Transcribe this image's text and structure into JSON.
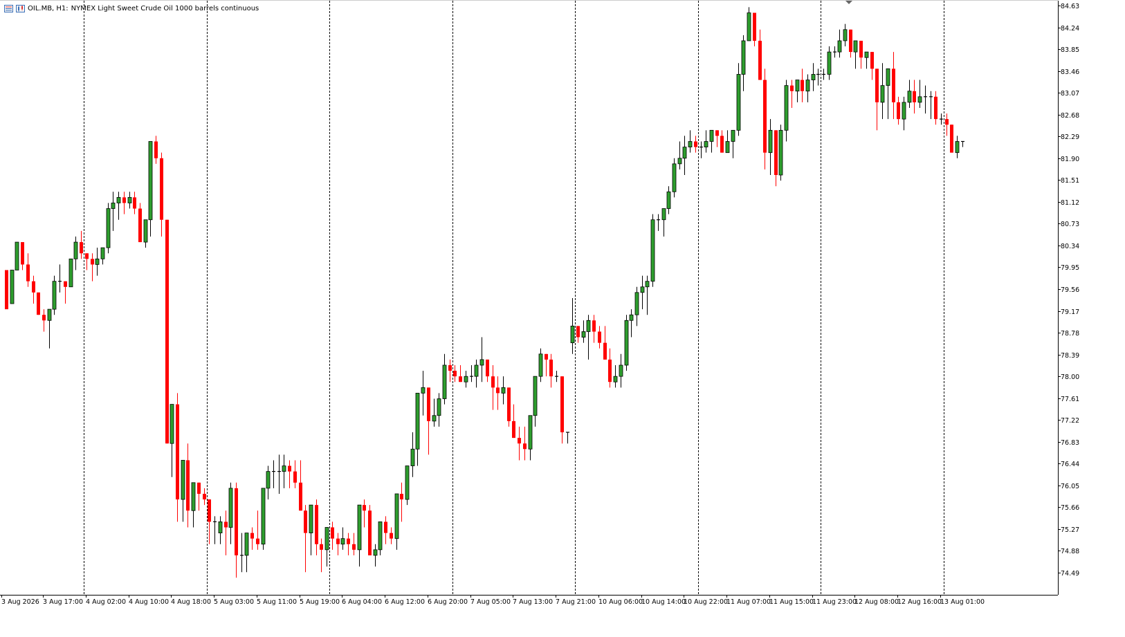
{
  "header": {
    "symbol": "OIL.MB, H1:",
    "description": "NYMEX Light Sweet Crude Oil 1000 barrels continuous",
    "icons": [
      "menu-icon",
      "chart-type-icon"
    ]
  },
  "colors": {
    "up": "#008000",
    "up_fill": "#2e9e2e",
    "down": "#ff0000",
    "grid_separator": "#000000",
    "axis": "#000000",
    "background": "#ffffff"
  },
  "chart_data": {
    "type": "candlestick",
    "timeframe": "H1",
    "ylim": [
      74.3,
      84.8
    ],
    "y_ticks": [
      "84.63",
      "84.24",
      "83.85",
      "83.46",
      "83.07",
      "82.68",
      "82.29",
      "81.90",
      "81.51",
      "81.12",
      "80.73",
      "80.34",
      "79.95",
      "79.56",
      "79.17",
      "78.78",
      "78.39",
      "78.00",
      "77.61",
      "77.22",
      "76.83",
      "76.44",
      "76.05",
      "75.66",
      "75.27",
      "74.88",
      "74.49"
    ],
    "x_labels": [
      "3 Aug 2026",
      "3 Aug 17:00",
      "4 Aug 02:00",
      "4 Aug 10:00",
      "4 Aug 18:00",
      "5 Aug 03:00",
      "5 Aug 11:00",
      "5 Aug 19:00",
      "6 Aug 04:00",
      "6 Aug 12:00",
      "6 Aug 20:00",
      "7 Aug 05:00",
      "7 Aug 13:00",
      "7 Aug 21:00",
      "10 Aug 06:00",
      "10 Aug 14:00",
      "10 Aug 22:00",
      "11 Aug 07:00",
      "11 Aug 15:00",
      "11 Aug 23:00",
      "12 Aug 08:00",
      "12 Aug 16:00",
      "13 Aug 01:00"
    ],
    "day_separators_after_candle": [
      14,
      37,
      60,
      83,
      106,
      129,
      152,
      175
    ],
    "candles": [
      [
        79.9,
        79.9,
        79.5,
        79.2
      ],
      [
        79.3,
        79.9,
        79.5,
        79.9
      ],
      [
        79.9,
        80.4,
        80.2,
        80.4
      ],
      [
        80.4,
        80.4,
        79.9,
        80.0
      ],
      [
        80.0,
        80.2,
        79.6,
        79.7
      ],
      [
        79.7,
        79.8,
        79.3,
        79.5
      ],
      [
        79.5,
        79.5,
        79.1,
        79.1
      ],
      [
        79.1,
        79.2,
        78.8,
        79.0
      ],
      [
        79.0,
        79.2,
        78.5,
        79.2
      ],
      [
        79.2,
        79.8,
        79.1,
        79.7
      ],
      [
        79.7,
        80.0,
        79.5,
        79.7
      ],
      [
        79.7,
        79.7,
        79.3,
        79.6
      ],
      [
        79.6,
        80.1,
        79.6,
        80.1
      ],
      [
        80.1,
        80.5,
        79.9,
        80.4
      ],
      [
        80.4,
        80.6,
        80.1,
        80.2
      ],
      [
        80.2,
        80.2,
        79.9,
        80.1
      ],
      [
        80.1,
        80.2,
        79.7,
        80.0
      ],
      [
        80.0,
        80.3,
        79.8,
        80.1
      ],
      [
        80.1,
        80.3,
        80.0,
        80.3
      ],
      [
        80.3,
        81.1,
        80.2,
        81.0
      ],
      [
        81.0,
        81.3,
        80.6,
        81.1
      ],
      [
        81.1,
        81.3,
        80.8,
        81.2
      ],
      [
        81.2,
        81.3,
        80.9,
        81.1
      ],
      [
        81.1,
        81.3,
        81.0,
        81.2
      ],
      [
        81.2,
        81.3,
        80.9,
        81.0
      ],
      [
        81.0,
        81.1,
        80.4,
        80.4
      ],
      [
        80.4,
        80.7,
        80.3,
        80.8
      ],
      [
        80.8,
        82.2,
        80.5,
        82.2
      ],
      [
        82.2,
        82.3,
        81.8,
        81.9
      ],
      [
        81.9,
        82.0,
        80.5,
        80.8
      ],
      [
        80.8,
        80.8,
        76.8,
        76.8
      ],
      [
        76.8,
        77.5,
        76.2,
        77.5
      ],
      [
        77.5,
        77.7,
        75.4,
        75.8
      ],
      [
        75.8,
        76.3,
        75.4,
        76.5
      ],
      [
        76.5,
        76.8,
        75.3,
        75.6
      ],
      [
        75.6,
        76.1,
        75.3,
        76.1
      ],
      [
        76.1,
        76.1,
        75.6,
        75.9
      ],
      [
        75.9,
        76.0,
        75.7,
        75.8
      ],
      [
        75.8,
        75.8,
        75.0,
        75.4
      ],
      [
        75.4,
        75.5,
        75.0,
        75.4
      ],
      [
        75.2,
        75.5,
        75.0,
        75.4
      ],
      [
        75.4,
        75.6,
        74.8,
        75.3
      ],
      [
        75.3,
        76.1,
        75.0,
        76.0
      ],
      [
        76.0,
        76.1,
        74.4,
        74.8
      ],
      [
        74.8,
        75.2,
        74.5,
        74.8
      ],
      [
        74.8,
        75.2,
        74.5,
        75.2
      ],
      [
        75.2,
        75.3,
        74.9,
        75.1
      ],
      [
        75.1,
        75.6,
        74.9,
        75.0
      ],
      [
        75.0,
        76.0,
        74.9,
        76.0
      ],
      [
        76.0,
        76.4,
        75.8,
        76.3
      ],
      [
        76.3,
        76.5,
        76.0,
        76.3
      ],
      [
        76.3,
        76.6,
        75.9,
        76.3
      ],
      [
        76.3,
        76.6,
        76.0,
        76.4
      ],
      [
        76.4,
        76.5,
        76.0,
        76.3
      ],
      [
        76.3,
        76.5,
        76.0,
        76.1
      ],
      [
        76.1,
        76.5,
        75.6,
        75.6
      ],
      [
        75.6,
        75.7,
        74.5,
        75.2
      ],
      [
        75.2,
        75.7,
        74.8,
        75.7
      ],
      [
        75.7,
        75.8,
        74.8,
        75.0
      ],
      [
        75.0,
        75.1,
        74.5,
        74.9
      ],
      [
        74.9,
        75.3,
        74.6,
        75.3
      ],
      [
        75.3,
        75.4,
        74.9,
        75.1
      ],
      [
        75.1,
        75.2,
        74.8,
        75.0
      ],
      [
        75.0,
        75.3,
        74.9,
        75.1
      ],
      [
        75.1,
        75.2,
        74.8,
        75.0
      ],
      [
        75.0,
        75.2,
        74.8,
        74.9
      ],
      [
        74.9,
        75.7,
        74.6,
        75.7
      ],
      [
        75.7,
        75.8,
        75.3,
        75.6
      ],
      [
        75.6,
        75.7,
        74.8,
        74.8
      ],
      [
        74.8,
        75.0,
        74.6,
        74.9
      ],
      [
        74.9,
        75.4,
        74.8,
        75.4
      ],
      [
        75.4,
        75.5,
        75.0,
        75.2
      ],
      [
        75.2,
        75.3,
        75.0,
        75.1
      ],
      [
        75.1,
        75.9,
        74.9,
        75.9
      ],
      [
        75.9,
        76.1,
        75.4,
        75.8
      ],
      [
        75.8,
        76.4,
        75.7,
        76.4
      ],
      [
        76.4,
        77.0,
        76.2,
        76.7
      ],
      [
        76.7,
        77.3,
        76.4,
        77.7
      ],
      [
        77.7,
        78.1,
        77.3,
        77.8
      ],
      [
        77.8,
        77.8,
        76.6,
        77.2
      ],
      [
        77.2,
        77.6,
        77.1,
        77.3
      ],
      [
        77.3,
        77.7,
        77.1,
        77.6
      ],
      [
        77.6,
        78.4,
        77.5,
        78.2
      ],
      [
        78.2,
        78.3,
        77.9,
        78.1
      ],
      [
        78.1,
        78.2,
        77.9,
        78.0
      ],
      [
        78.0,
        78.2,
        77.9,
        77.9
      ],
      [
        77.9,
        78.1,
        77.8,
        78.0
      ],
      [
        78.0,
        78.2,
        77.9,
        78.0
      ],
      [
        78.0,
        78.3,
        77.8,
        78.2
      ],
      [
        78.2,
        78.7,
        77.9,
        78.3
      ],
      [
        78.3,
        78.3,
        77.9,
        78.0
      ],
      [
        78.0,
        78.2,
        77.4,
        77.8
      ],
      [
        77.8,
        78.0,
        77.4,
        77.7
      ],
      [
        77.7,
        78.0,
        77.5,
        77.8
      ],
      [
        77.8,
        77.8,
        77.1,
        77.2
      ],
      [
        77.2,
        77.5,
        76.9,
        76.9
      ],
      [
        76.9,
        77.1,
        76.5,
        76.8
      ],
      [
        76.8,
        77.1,
        76.5,
        76.7
      ],
      [
        76.7,
        77.3,
        76.5,
        77.3
      ],
      [
        77.3,
        78.0,
        77.1,
        78.0
      ],
      [
        78.0,
        78.5,
        77.9,
        78.4
      ],
      [
        78.4,
        78.4,
        78.0,
        78.3
      ],
      [
        78.3,
        78.4,
        77.8,
        78.0
      ],
      [
        78.0,
        78.1,
        77.9,
        78.0
      ],
      [
        78.0,
        78.0,
        76.8,
        77.0
      ],
      [
        77.0,
        77.0,
        76.8,
        77.0
      ],
      [
        78.6,
        79.4,
        78.4,
        78.9
      ],
      [
        78.9,
        78.9,
        78.6,
        78.7
      ],
      [
        78.7,
        79.0,
        78.6,
        78.8
      ],
      [
        78.8,
        79.1,
        78.3,
        79.0
      ],
      [
        79.0,
        79.1,
        78.6,
        78.8
      ],
      [
        78.8,
        78.9,
        78.5,
        78.6
      ],
      [
        78.6,
        78.9,
        78.4,
        78.3
      ],
      [
        78.3,
        78.5,
        77.8,
        77.9
      ],
      [
        77.9,
        78.2,
        77.8,
        78.0
      ],
      [
        78.0,
        78.4,
        77.8,
        78.2
      ],
      [
        78.2,
        79.1,
        78.1,
        79.0
      ],
      [
        79.0,
        79.2,
        78.7,
        79.1
      ],
      [
        79.1,
        79.6,
        78.9,
        79.5
      ],
      [
        79.5,
        79.8,
        79.2,
        79.6
      ],
      [
        79.6,
        79.8,
        79.1,
        79.7
      ],
      [
        79.7,
        80.9,
        79.6,
        80.8
      ],
      [
        80.8,
        80.9,
        80.6,
        80.8
      ],
      [
        80.8,
        81.0,
        80.5,
        81.0
      ],
      [
        81.0,
        81.4,
        80.9,
        81.3
      ],
      [
        81.3,
        81.9,
        81.2,
        81.8
      ],
      [
        81.8,
        82.2,
        81.7,
        81.9
      ],
      [
        81.9,
        82.3,
        81.6,
        82.1
      ],
      [
        82.1,
        82.4,
        82.0,
        82.2
      ],
      [
        82.2,
        82.3,
        82.0,
        82.1
      ],
      [
        82.1,
        82.2,
        81.9,
        82.1
      ],
      [
        82.1,
        82.4,
        82.0,
        82.2
      ],
      [
        82.2,
        82.4,
        82.0,
        82.4
      ],
      [
        82.4,
        82.4,
        82.1,
        82.3
      ],
      [
        82.3,
        82.4,
        82.0,
        82.0
      ],
      [
        82.0,
        82.4,
        82.0,
        82.2
      ],
      [
        82.2,
        82.4,
        81.9,
        82.4
      ],
      [
        82.4,
        83.6,
        82.3,
        83.4
      ],
      [
        83.4,
        84.1,
        83.1,
        84.0
      ],
      [
        84.0,
        84.6,
        84.0,
        84.5
      ],
      [
        84.5,
        84.5,
        83.9,
        84.0
      ],
      [
        84.0,
        84.2,
        83.4,
        83.3
      ],
      [
        83.3,
        83.5,
        81.7,
        82.0
      ],
      [
        82.0,
        82.6,
        81.6,
        82.4
      ],
      [
        82.4,
        82.4,
        81.4,
        81.6
      ],
      [
        81.6,
        82.5,
        81.5,
        82.4
      ],
      [
        82.4,
        83.3,
        82.2,
        83.2
      ],
      [
        83.2,
        83.3,
        82.8,
        83.1
      ],
      [
        83.1,
        83.3,
        82.9,
        83.3
      ],
      [
        83.3,
        83.5,
        82.9,
        83.1
      ],
      [
        83.1,
        83.4,
        82.9,
        83.3
      ],
      [
        83.3,
        83.6,
        83.1,
        83.4
      ],
      [
        83.4,
        83.5,
        83.2,
        83.4
      ],
      [
        83.4,
        83.5,
        83.3,
        83.4
      ],
      [
        83.4,
        83.9,
        83.3,
        83.8
      ],
      [
        83.8,
        83.9,
        83.7,
        83.8
      ],
      [
        83.8,
        84.2,
        83.7,
        84.0
      ],
      [
        84.0,
        84.3,
        83.9,
        84.2
      ],
      [
        84.2,
        84.2,
        83.7,
        83.8
      ],
      [
        83.8,
        84.0,
        83.5,
        84.0
      ],
      [
        84.0,
        84.0,
        83.5,
        83.7
      ],
      [
        83.7,
        83.8,
        83.5,
        83.8
      ],
      [
        83.8,
        83.8,
        83.3,
        83.5
      ],
      [
        83.5,
        83.5,
        82.4,
        82.9
      ],
      [
        82.9,
        83.6,
        82.6,
        83.2
      ],
      [
        83.2,
        83.4,
        82.6,
        83.5
      ],
      [
        83.5,
        83.8,
        82.6,
        82.9
      ],
      [
        82.9,
        83.0,
        82.5,
        82.6
      ],
      [
        82.6,
        83.0,
        82.4,
        82.9
      ],
      [
        82.9,
        83.3,
        82.8,
        83.1
      ],
      [
        83.1,
        83.3,
        82.7,
        82.9
      ],
      [
        82.9,
        83.3,
        82.8,
        83.0
      ],
      [
        83.0,
        83.2,
        82.7,
        83.0
      ],
      [
        83.0,
        83.1,
        82.6,
        83.0
      ],
      [
        83.0,
        83.1,
        82.5,
        82.6
      ],
      [
        82.6,
        82.7,
        82.5,
        82.6
      ],
      [
        82.6,
        82.7,
        82.3,
        82.5
      ],
      [
        82.5,
        82.5,
        82.0,
        82.0
      ],
      [
        82.0,
        82.3,
        81.9,
        82.2
      ],
      [
        82.2,
        82.2,
        82.1,
        82.2
      ]
    ]
  }
}
